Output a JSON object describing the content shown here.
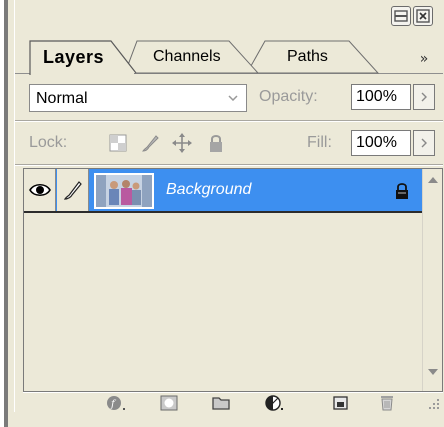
{
  "tabs": [
    {
      "label": "Layers",
      "active": true
    },
    {
      "label": "Channels",
      "active": false
    },
    {
      "label": "Paths",
      "active": false
    }
  ],
  "blend": {
    "mode": "Normal",
    "opacity_label": "Opacity:",
    "opacity_value": "100%"
  },
  "lock": {
    "label": "Lock:",
    "fill_label": "Fill:",
    "fill_value": "100%"
  },
  "layers": [
    {
      "name": "Background",
      "visible": true,
      "locked": true,
      "selected": true
    }
  ],
  "icons": {
    "window": [
      "minimize-icon",
      "close-icon"
    ],
    "menu": "double-chevron-icon",
    "lock": [
      "lock-transparent-icon",
      "lock-paint-icon",
      "lock-move-icon",
      "lock-all-icon"
    ],
    "bottom": [
      "layer-style-icon",
      "add-mask-icon",
      "new-group-icon",
      "adjustment-layer-icon",
      "new-layer-icon",
      "delete-layer-icon"
    ]
  },
  "colors": {
    "selection": "#3d8ff0",
    "panel": "#ece9d8"
  }
}
